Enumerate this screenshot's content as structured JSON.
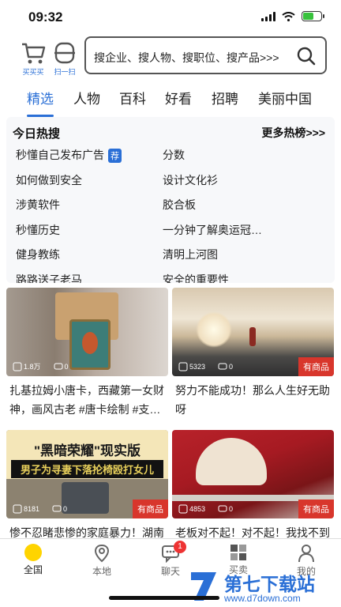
{
  "status": {
    "time": "09:32"
  },
  "topbar": {
    "buy_label": "买买买",
    "scan_label": "扫一扫",
    "search_placeholder": "搜企业、搜人物、搜职位、搜产品>>>"
  },
  "tabs": [
    "精选",
    "人物",
    "百科",
    "好看",
    "招聘",
    "美丽中国"
  ],
  "hot": {
    "title": "今日热搜",
    "more": "更多热榜>>>",
    "badge": "荐",
    "left": [
      "秒懂自己发布广告",
      "如何做到安全",
      "涉黄软件",
      "秒懂历史",
      "健身教练",
      "路路送子老马"
    ],
    "right": [
      "分数",
      "设计文化衫",
      "胶合板",
      "一分钟了解奥运冠…",
      "清明上河图",
      "安全的重要性"
    ]
  },
  "cards": [
    {
      "likes": "1.8万",
      "comments": "0",
      "badge": "",
      "title": "扎基拉姆小唐卡，西藏第一女财神，画风古老 #唐卡绘制 #支…"
    },
    {
      "likes": "5323",
      "comments": "0",
      "badge": "有商品",
      "title": "努力不能成功！那么人生好无助呀"
    },
    {
      "likes": "8181",
      "comments": "0",
      "badge": "有商品",
      "title": "惨不忍睹悲惨的家庭暴力！湖南",
      "banner1": "\"黑暗荣耀\"现实版",
      "banner2": "男子为寻妻下落抡椅殴打女儿"
    },
    {
      "likes": "4853",
      "comments": "0",
      "badge": "有商品",
      "title": "老板对不起！对不起！我找不到"
    }
  ],
  "nav": [
    {
      "label": "全国"
    },
    {
      "label": "本地"
    },
    {
      "label": "聊天",
      "count": "1"
    },
    {
      "label": "买卖"
    },
    {
      "label": "我的"
    }
  ],
  "watermark": {
    "name": "第七下载站",
    "url": "www.d7down.com"
  },
  "colors": {
    "accent": "#2a6fd6",
    "badge": "#d8362c",
    "home": "#ffd400"
  }
}
